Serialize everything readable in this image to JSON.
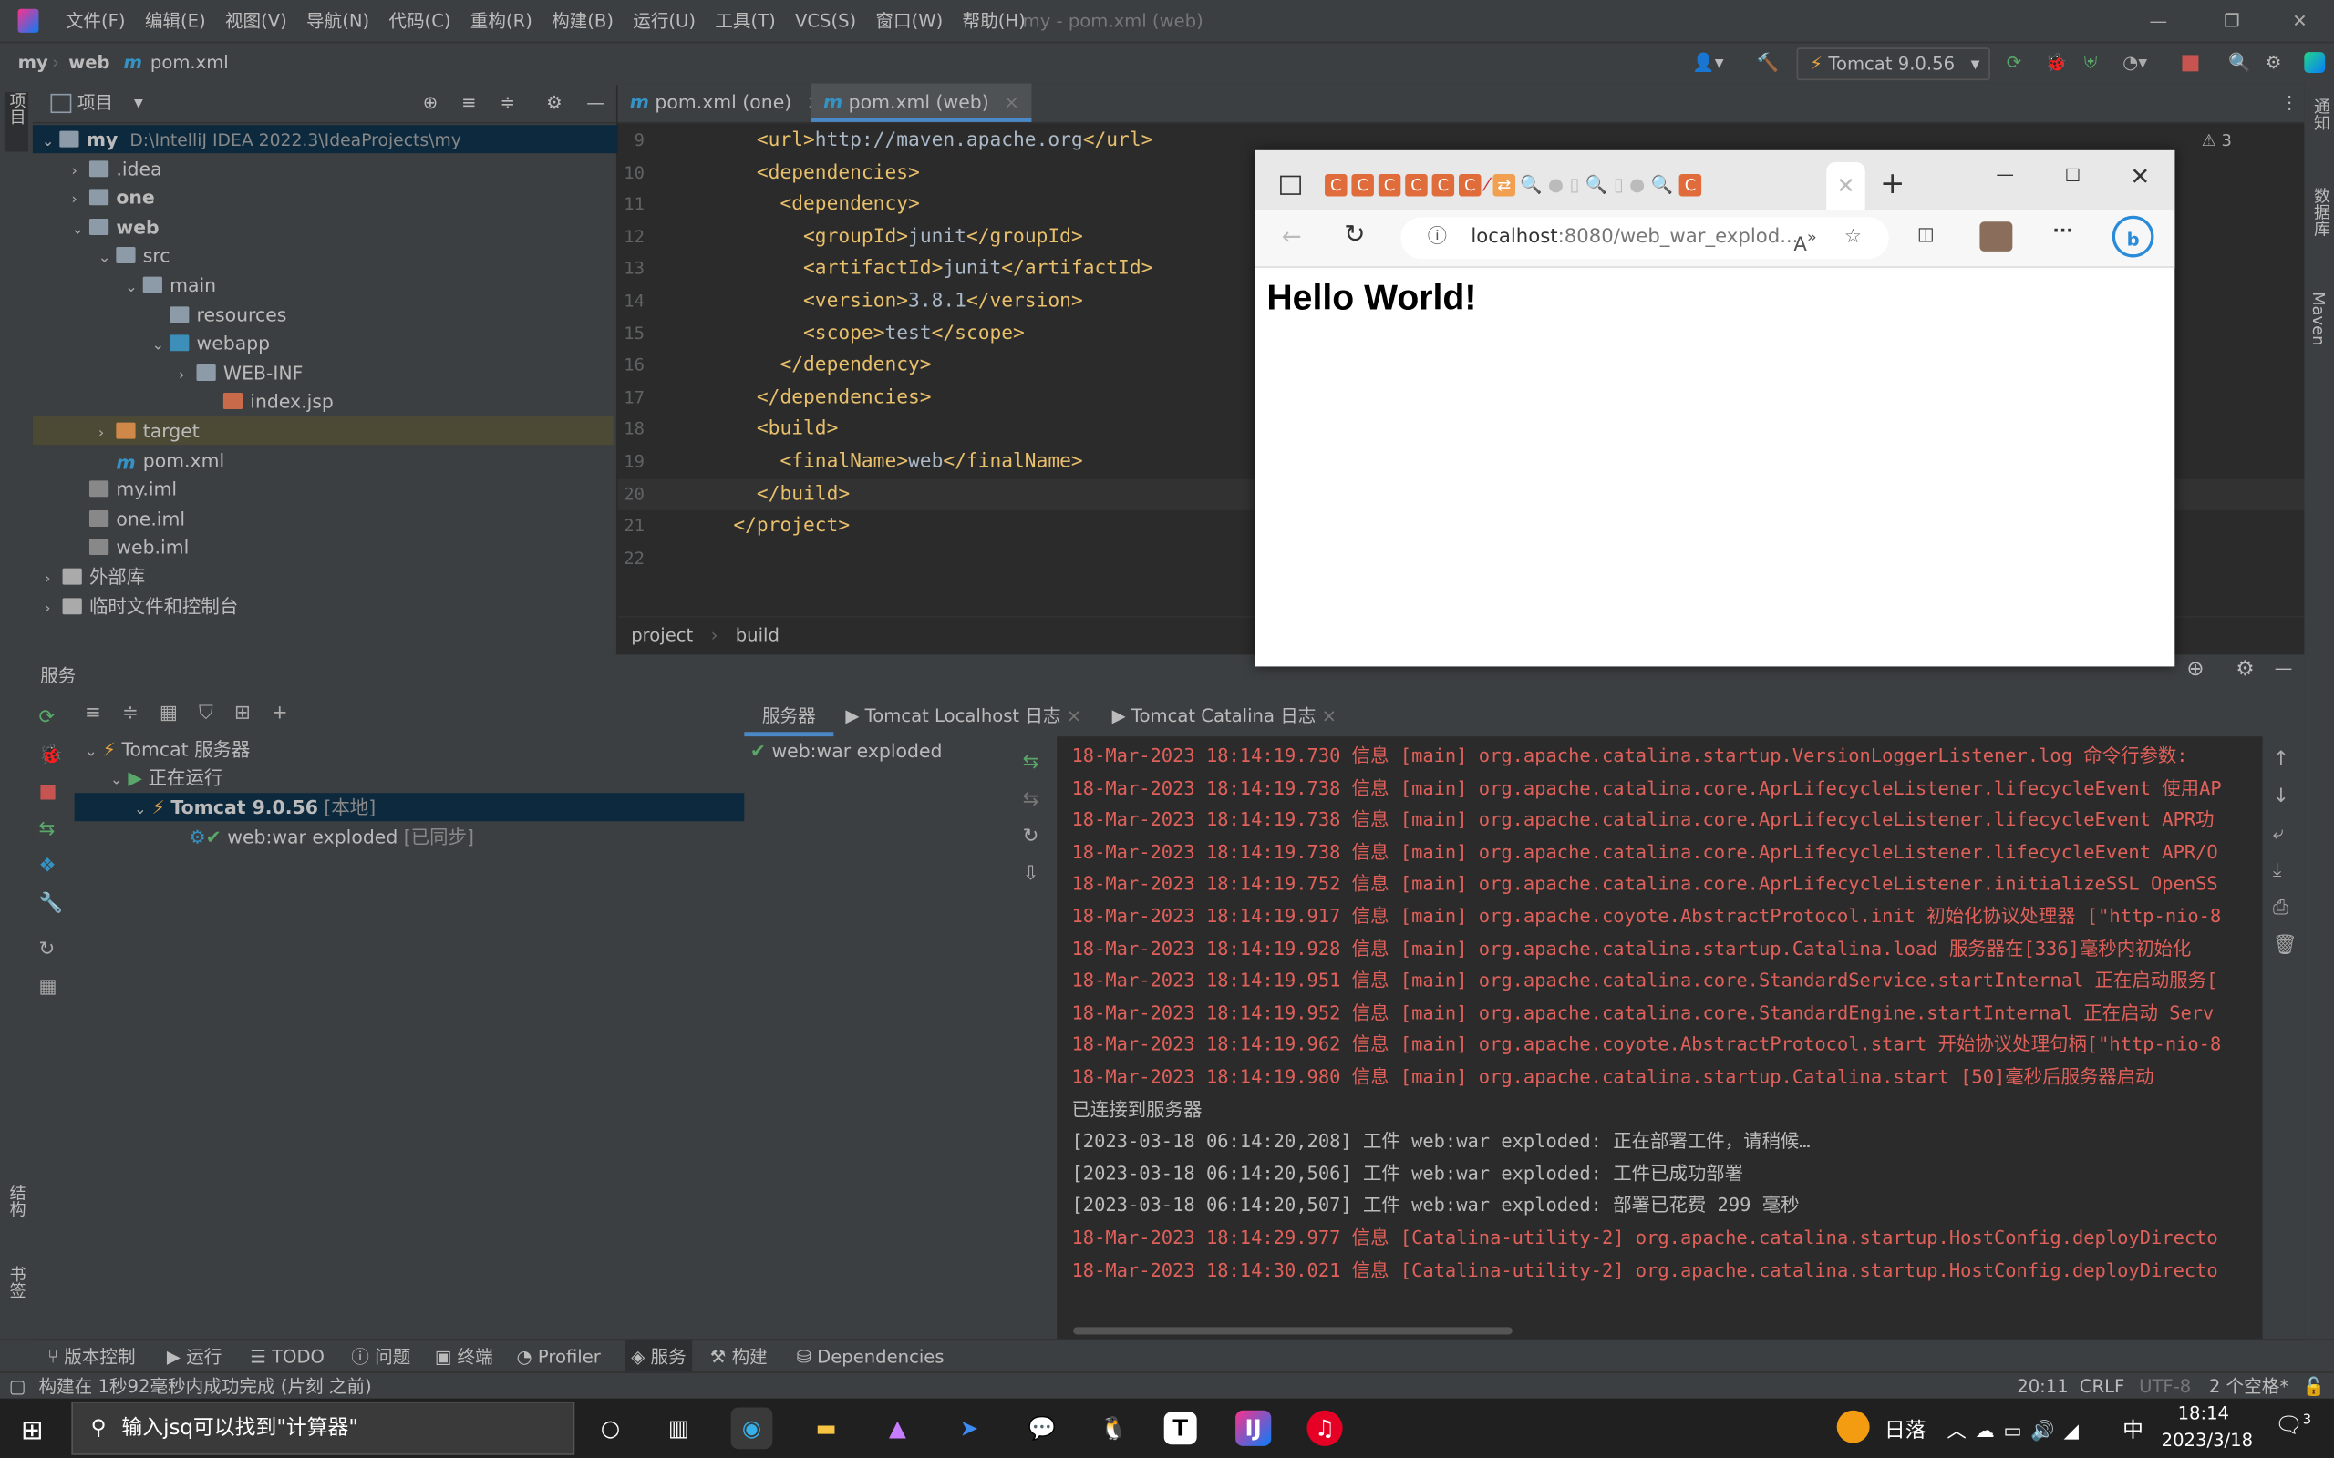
{
  "menubar": {
    "items": [
      "文件(F)",
      "编辑(E)",
      "视图(V)",
      "导航(N)",
      "代码(C)",
      "重构(R)",
      "构建(B)",
      "运行(U)",
      "工具(T)",
      "VCS(S)",
      "窗口(W)",
      "帮助(H)"
    ],
    "window_title": "my - pom.xml (web)"
  },
  "navbar": {
    "breadcrumb": [
      "my",
      "web",
      "pom.xml"
    ],
    "run_config": "Tomcat 9.0.56"
  },
  "left_strip": {
    "project_label": "项目",
    "structure_label": "结构",
    "bookmarks_label": "书签"
  },
  "right_strip": {
    "notifications": "通知",
    "database": "数据库",
    "maven": "Maven"
  },
  "project": {
    "title": "项目",
    "tree": [
      {
        "label": "my",
        "extra": "D:\\IntelliJ IDEA 2022.3\\IdeaProjects\\my"
      },
      {
        "label": ".idea"
      },
      {
        "label": "one"
      },
      {
        "label": "web"
      },
      {
        "label": "src"
      },
      {
        "label": "main"
      },
      {
        "label": "resources"
      },
      {
        "label": "webapp"
      },
      {
        "label": "WEB-INF"
      },
      {
        "label": "index.jsp"
      },
      {
        "label": "target"
      },
      {
        "label": "pom.xml"
      },
      {
        "label": "my.iml"
      },
      {
        "label": "one.iml"
      },
      {
        "label": "web.iml"
      },
      {
        "label": "外部库"
      },
      {
        "label": "临时文件和控制台"
      }
    ]
  },
  "editor": {
    "tabs": [
      {
        "label": "pom.xml (one)"
      },
      {
        "label": "pom.xml (web)",
        "active": true
      }
    ],
    "warnings": "3",
    "lines": [
      {
        "n": "9",
        "code": "    <url>http://maven.apache.org</url>"
      },
      {
        "n": "10",
        "code": "    <dependencies>"
      },
      {
        "n": "11",
        "code": "      <dependency>"
      },
      {
        "n": "12",
        "code": "        <groupId>junit</groupId>"
      },
      {
        "n": "13",
        "code": "        <artifactId>junit</artifactId>"
      },
      {
        "n": "14",
        "code": "        <version>3.8.1</version>"
      },
      {
        "n": "15",
        "code": "        <scope>test</scope>"
      },
      {
        "n": "16",
        "code": "      </dependency>"
      },
      {
        "n": "17",
        "code": "    </dependencies>"
      },
      {
        "n": "18",
        "code": "    <build>"
      },
      {
        "n": "19",
        "code": "      <finalName>web</finalName>"
      },
      {
        "n": "20",
        "code": "    </build>"
      },
      {
        "n": "21",
        "code": "  </project>"
      },
      {
        "n": "22",
        "code": ""
      }
    ],
    "breadcrumb": [
      "project",
      "build"
    ]
  },
  "browser": {
    "url_host": "localhost",
    "url_rest": ":8080/web_war_explod...",
    "heading": "Hello World!"
  },
  "services": {
    "title": "服务",
    "tree": {
      "root": "Tomcat 服务器",
      "running": "正在运行",
      "server": "Tomcat 9.0.56",
      "server_tag": "[本地]",
      "artifact": "web:war exploded",
      "artifact_tag": "[已同步]"
    },
    "tabs": [
      "服务器",
      "Tomcat Localhost 日志",
      "Tomcat Catalina 日志"
    ],
    "deployment": "web:war exploded",
    "log": [
      {
        "text": "18-Mar-2023 18:14:19.730 信息 [main] org.apache.catalina.startup.VersionLoggerListener.log 命令行参数:",
        "level": "err"
      },
      {
        "text": "18-Mar-2023 18:14:19.738 信息 [main] org.apache.catalina.core.AprLifecycleListener.lifecycleEvent 使用AP",
        "level": "err"
      },
      {
        "text": "18-Mar-2023 18:14:19.738 信息 [main] org.apache.catalina.core.AprLifecycleListener.lifecycleEvent APR功",
        "level": "err"
      },
      {
        "text": "18-Mar-2023 18:14:19.738 信息 [main] org.apache.catalina.core.AprLifecycleListener.lifecycleEvent APR/O",
        "level": "err"
      },
      {
        "text": "18-Mar-2023 18:14:19.752 信息 [main] org.apache.catalina.core.AprLifecycleListener.initializeSSL OpenSS",
        "level": "err"
      },
      {
        "text": "18-Mar-2023 18:14:19.917 信息 [main] org.apache.coyote.AbstractProtocol.init 初始化协议处理器 [\"http-nio-8",
        "level": "err"
      },
      {
        "text": "18-Mar-2023 18:14:19.928 信息 [main] org.apache.catalina.startup.Catalina.load 服务器在[336]毫秒内初始化",
        "level": "err"
      },
      {
        "text": "18-Mar-2023 18:14:19.951 信息 [main] org.apache.catalina.core.StandardService.startInternal 正在启动服务[",
        "level": "err"
      },
      {
        "text": "18-Mar-2023 18:14:19.952 信息 [main] org.apache.catalina.core.StandardEngine.startInternal 正在启动 Serv",
        "level": "err"
      },
      {
        "text": "18-Mar-2023 18:14:19.962 信息 [main] org.apache.coyote.AbstractProtocol.start 开始协议处理句柄[\"http-nio-8",
        "level": "err"
      },
      {
        "text": "18-Mar-2023 18:14:19.980 信息 [main] org.apache.catalina.startup.Catalina.start [50]毫秒后服务器启动",
        "level": "err"
      },
      {
        "text": "已连接到服务器",
        "level": "plain"
      },
      {
        "text": "[2023-03-18 06:14:20,208] 工件 web:war exploded: 正在部署工件，请稍候…",
        "level": "plain"
      },
      {
        "text": "[2023-03-18 06:14:20,506] 工件 web:war exploded: 工件已成功部署",
        "level": "plain"
      },
      {
        "text": "[2023-03-18 06:14:20,507] 工件 web:war exploded: 部署已花费 299 毫秒",
        "level": "plain"
      },
      {
        "text": "18-Mar-2023 18:14:29.977 信息 [Catalina-utility-2] org.apache.catalina.startup.HostConfig.deployDirecto",
        "level": "err"
      },
      {
        "text": "18-Mar-2023 18:14:30.021 信息 [Catalina-utility-2] org.apache.catalina.startup.HostConfig.deployDirecto",
        "level": "err"
      }
    ]
  },
  "toolwindows": [
    "版本控制",
    "运行",
    "TODO",
    "问题",
    "终端",
    "Profiler",
    "服务",
    "构建",
    "Dependencies"
  ],
  "statusbar": {
    "message": "构建在 1秒92毫秒内成功完成 (片刻 之前)",
    "position": "20:11",
    "line_sep": "CRLF",
    "encoding": "UTF-8",
    "indent": "2 个空格*"
  },
  "taskbar": {
    "search_placeholder": "输入jsq可以找到\"计算器\"",
    "weather": "日落",
    "ime": "中",
    "time": "18:14",
    "date": "2023/3/18",
    "notifications": "3"
  },
  "colors": {
    "accent": "#3592c4",
    "error_log": "#e0605a",
    "tag": "#e8bf6a",
    "selection": "#0d293e"
  }
}
